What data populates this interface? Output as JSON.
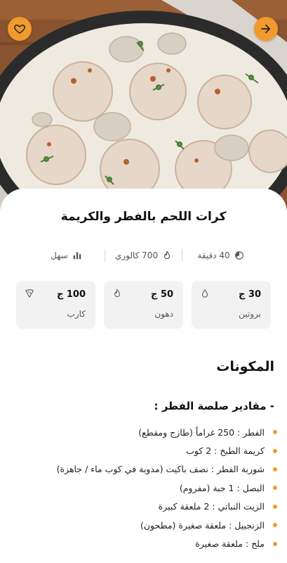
{
  "recipe": {
    "title": "كرات اللحم بالفطر والكريمة"
  },
  "meta": {
    "time": "40 دقيقة",
    "calories": "700 كالوري",
    "difficulty": "سهل"
  },
  "macros": [
    {
      "value": "30 ج",
      "name": "بروتين",
      "icon": "protein-drop-icon"
    },
    {
      "value": "50 ج",
      "name": "دهون",
      "icon": "fat-flame-icon"
    },
    {
      "value": "100 ج",
      "name": "كارب",
      "icon": "carb-pizza-icon"
    }
  ],
  "ingredients": {
    "heading": "المكونات",
    "group_title": "- مقادير صلصة الفطر :",
    "items": [
      "الفطر : 250 غراماً (طازج ومقطع)",
      "كريمة الطبخ : 2 كوب",
      "شوربة الفطر : نصف باكيت (مذوبة في كوب ماء / جاهزة)",
      "البصل : 1 حبة (مفروم)",
      "الزيت النباتي : 2 ملعقة كبيرة",
      "الزنجبيل : ملعقة صغيرة (مطحون)",
      "ملح : ملعقة صغيرة"
    ]
  },
  "colors": {
    "accent": "#f29a2e",
    "card_bg": "#f2f2f2"
  }
}
